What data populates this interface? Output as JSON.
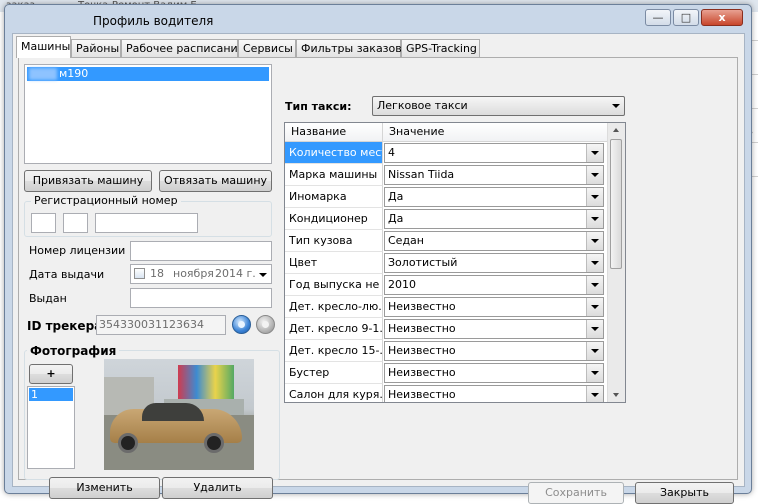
{
  "background": {
    "fragment_left": "заказ",
    "fragment_mid": "Точка-Ремонт Вадим Е.",
    "side_mark": "ь"
  },
  "window": {
    "title": "Профиль водителя",
    "minimize_glyph": "—",
    "maximize_glyph": "□",
    "close_glyph": "x",
    "colors": {
      "frame": "#c9d7e8",
      "selection": "#3399ff",
      "close": "#c8462b"
    }
  },
  "tabs": [
    {
      "label": "Машины",
      "active": true
    },
    {
      "label": "Районы"
    },
    {
      "label": "Рабочее расписание"
    },
    {
      "label": "Сервисы"
    },
    {
      "label": "Фильтры заказов"
    },
    {
      "label": "GPS-Tracking"
    }
  ],
  "cars": {
    "items": [
      "м190"
    ],
    "selected_index": 0
  },
  "buttons": {
    "attach_car": "Привязать машину",
    "detach_car": "Отвязать машину",
    "add_photo": "+",
    "change": "Изменить",
    "delete": "Удалить",
    "save": "Сохранить",
    "close": "Закрыть"
  },
  "registration": {
    "group_label": "Регистрационный номер",
    "part1": "",
    "part2": "",
    "part3": ""
  },
  "license": {
    "label": "Номер лицензии",
    "value": ""
  },
  "issue_date": {
    "label": "Дата выдачи",
    "day": "18",
    "month": "ноября",
    "year": "2014 г."
  },
  "issued_by": {
    "label": "Выдан",
    "value": ""
  },
  "tracker": {
    "label": "ID трекера",
    "value": "354330031123634"
  },
  "photos": {
    "label": "Фотография",
    "items": [
      "1"
    ],
    "selected_index": 0
  },
  "taxi_type": {
    "label": "Тип такси:",
    "value": "Легковое такси"
  },
  "grid": {
    "columns": [
      "Название",
      "Значение"
    ],
    "rows": [
      {
        "name": "Количество мест",
        "value": "4",
        "selected": true
      },
      {
        "name": "Марка машины",
        "value": "Nissan Tiida"
      },
      {
        "name": "Иномарка",
        "value": "Да"
      },
      {
        "name": "Кондиционер",
        "value": "Да"
      },
      {
        "name": "Тип кузова",
        "value": "Седан"
      },
      {
        "name": "Цвет",
        "value": "Золотистый"
      },
      {
        "name": "Год выпуска не ...",
        "value": "2010"
      },
      {
        "name": "Дет. кресло-лю...",
        "value": "Неизвестно"
      },
      {
        "name": "Дет. кресло 9-1...",
        "value": "Неизвестно"
      },
      {
        "name": "Дет.  кресло 15-...",
        "value": "Неизвестно"
      },
      {
        "name": "Бустер",
        "value": "Неизвестно"
      },
      {
        "name": "Салон для куря...",
        "value": "Неизвестно"
      }
    ]
  }
}
